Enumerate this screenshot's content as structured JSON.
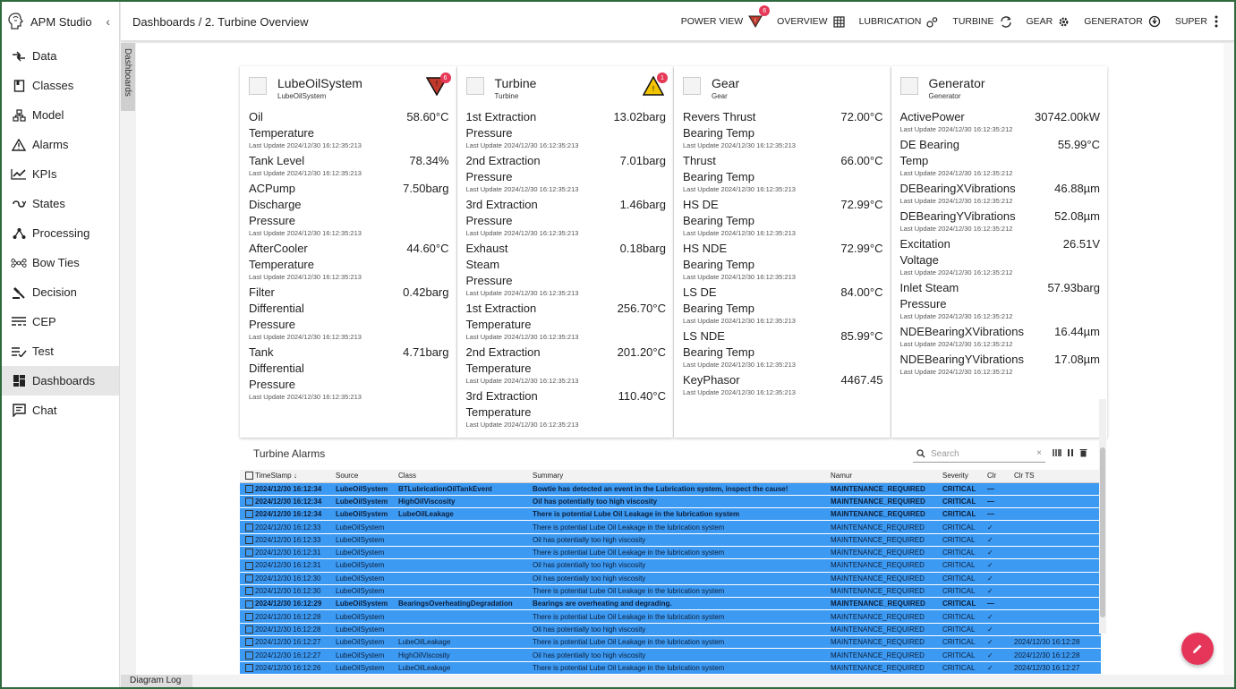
{
  "app": {
    "title": "APM Studio"
  },
  "sidebar": {
    "items": [
      {
        "label": "Data",
        "icon": "data-arrows-icon"
      },
      {
        "label": "Classes",
        "icon": "book-icon"
      },
      {
        "label": "Model",
        "icon": "tree-icon"
      },
      {
        "label": "Alarms",
        "icon": "warning-icon"
      },
      {
        "label": "KPIs",
        "icon": "chart-line-icon"
      },
      {
        "label": "States",
        "icon": "route-icon"
      },
      {
        "label": "Processing",
        "icon": "graph-icon"
      },
      {
        "label": "Bow Ties",
        "icon": "bowtie-icon"
      },
      {
        "label": "Decision",
        "icon": "gavel-icon"
      },
      {
        "label": "CEP",
        "icon": "cep-icon"
      },
      {
        "label": "Test",
        "icon": "checklist-icon"
      },
      {
        "label": "Dashboards",
        "icon": "dashboard-icon",
        "active": true
      },
      {
        "label": "Chat",
        "icon": "chat-icon"
      }
    ]
  },
  "sidetab": {
    "label": "Dashboards"
  },
  "header": {
    "breadcrumb": "Dashboards / 2. Turbine Overview",
    "links": [
      {
        "label": "POWER VIEW",
        "badge": "6"
      },
      {
        "label": "OVERVIEW"
      },
      {
        "label": "LUBRICATION"
      },
      {
        "label": "TURBINE"
      },
      {
        "label": "GEAR"
      },
      {
        "label": "GENERATOR"
      },
      {
        "label": "SUPER"
      }
    ]
  },
  "cards": [
    {
      "title": "LubeOilSystem",
      "subtitle": "LubeOilSystem",
      "alarm_badge": "6",
      "alarm_color": "#c0392b",
      "metrics": [
        {
          "name": "Oil\nTemperature",
          "value": "58.60°C",
          "update": "Last Update 2024/12/30 16:12:35:213"
        },
        {
          "name": "Tank Level",
          "value": "78.34%",
          "update": "Last Update 2024/12/30 16:12:35:213"
        },
        {
          "name": "ACPump\nDischarge\nPressure",
          "value": "7.50barg",
          "update": "Last Update 2024/12/30 16:12:35:213"
        },
        {
          "name": "AfterCooler\nTemperature",
          "value": "44.60°C",
          "update": "Last Update 2024/12/30 16:12:35:213"
        },
        {
          "name": "Filter\nDifferential\nPressure",
          "value": "0.42barg",
          "update": "Last Update 2024/12/30 16:12:35:213"
        },
        {
          "name": "Tank\nDifferential\nPressure",
          "value": "4.71barg",
          "update": "Last Update 2024/12/30 16:12:35:213"
        }
      ]
    },
    {
      "title": "Turbine",
      "subtitle": "Turbine",
      "alarm_badge": "1",
      "alarm_color": "#f2c400",
      "metrics": [
        {
          "name": "1st Extraction\nPressure",
          "value": "13.02barg",
          "update": "Last Update 2024/12/30 16:12:35:213"
        },
        {
          "name": "2nd Extraction\nPressure",
          "value": "7.01barg",
          "update": "Last Update 2024/12/30 16:12:35:213"
        },
        {
          "name": "3rd Extraction\nPressure",
          "value": "1.46barg",
          "update": "Last Update 2024/12/30 16:12:35:213"
        },
        {
          "name": "Exhaust\nSteam\nPressure",
          "value": "0.18barg",
          "update": "Last Update 2024/12/30 16:12:35:213"
        },
        {
          "name": "1st Extraction\nTemperature",
          "value": "256.70°C",
          "update": "Last Update 2024/12/30 16:12:35:213"
        },
        {
          "name": "2nd Extraction\nTemperature",
          "value": "201.20°C",
          "update": "Last Update 2024/12/30 16:12:35:213"
        },
        {
          "name": "3rd Extraction\nTemperature",
          "value": "110.40°C",
          "update": "Last Update 2024/12/30 16:12:35:213"
        }
      ]
    },
    {
      "title": "Gear",
      "subtitle": "Gear",
      "alarm_badge": "",
      "alarm_color": "",
      "metrics": [
        {
          "name": "Revers Thrust\nBearing Temp",
          "value": "72.00°C",
          "update": "Last Update 2024/12/30 16:12:35:213"
        },
        {
          "name": "Thrust\nBearing Temp",
          "value": "66.00°C",
          "update": "Last Update 2024/12/30 16:12:35:213"
        },
        {
          "name": "HS DE\nBearing Temp",
          "value": "72.99°C",
          "update": "Last Update 2024/12/30 16:12:35:213"
        },
        {
          "name": "HS NDE\nBearing Temp",
          "value": "72.99°C",
          "update": "Last Update 2024/12/30 16:12:35:213"
        },
        {
          "name": "LS DE\nBearing Temp",
          "value": "84.00°C",
          "update": "Last Update 2024/12/30 16:12:35:213"
        },
        {
          "name": "LS NDE\nBearing Temp",
          "value": "85.99°C",
          "update": "Last Update 2024/12/30 16:12:35:213"
        },
        {
          "name": "KeyPhasor",
          "value": "4467.45",
          "update": "Last Update 2024/12/30 16:12:35:213"
        }
      ]
    },
    {
      "title": "Generator",
      "subtitle": "Generator",
      "alarm_badge": "",
      "alarm_color": "",
      "metrics": [
        {
          "name": "ActivePower",
          "value": "30742.00kW",
          "update": "Last Update 2024/12/30 16:12:35:212"
        },
        {
          "name": "DE Bearing\nTemp",
          "value": "55.99°C",
          "update": "Last Update 2024/12/30 16:12:35:212"
        },
        {
          "name": "DEBearingXVibrations",
          "value": "46.88µm",
          "update": "Last Update 2024/12/30 16:12:35:212"
        },
        {
          "name": "DEBearingYVibrations",
          "value": "52.08µm",
          "update": "Last Update 2024/12/30 16:12:35:212"
        },
        {
          "name": "Excitation\nVoltage",
          "value": "26.51V",
          "update": "Last Update 2024/12/30 16:12:35:212"
        },
        {
          "name": "Inlet Steam\nPressure",
          "value": "57.93barg",
          "update": "Last Update 2024/12/30 16:12:35:212"
        },
        {
          "name": "NDEBearingXVibrations",
          "value": "16.44µm",
          "update": "Last Update 2024/12/30 16:12:35:212"
        },
        {
          "name": "NDEBearingYVibrations",
          "value": "17.08µm",
          "update": "Last Update 2024/12/30 16:12:35:212"
        }
      ]
    }
  ],
  "alarms": {
    "title": "Turbine Alarms",
    "search_placeholder": "Search",
    "columns": [
      "TimeStamp",
      "Source",
      "Class",
      "Summary",
      "Namur",
      "Severity",
      "Clr",
      "Clr TS"
    ],
    "rows": [
      {
        "ts": "2024/12/30 16:12:34",
        "src": "LubeOilSystem",
        "cls": "BTLubricationOilTankEvent",
        "sum": "Bowtie has detected an event in the Lubrication system, inspect the cause!",
        "namur": "MAINTENANCE_REQUIRED",
        "sev": "CRITICAL",
        "clr": "—",
        "clrts": "",
        "bold": true
      },
      {
        "ts": "2024/12/30 16:12:34",
        "src": "LubeOilSystem",
        "cls": "HighOilViscosity",
        "sum": "Oil has potentially too high viscosity",
        "namur": "MAINTENANCE_REQUIRED",
        "sev": "CRITICAL",
        "clr": "—",
        "clrts": "",
        "bold": true
      },
      {
        "ts": "2024/12/30 16:12:34",
        "src": "LubeOilSystem",
        "cls": "LubeOilLeakage",
        "sum": "There is potential Lube Oil Leakage in the lubrication system",
        "namur": "MAINTENANCE_REQUIRED",
        "sev": "CRITICAL",
        "clr": "—",
        "clrts": "",
        "bold": true
      },
      {
        "ts": "2024/12/30 16:12:33",
        "src": "LubeOilSystem",
        "cls": "",
        "sum": "There is potential Lube Oil Leakage in the lubrication system",
        "namur": "MAINTENANCE_REQUIRED",
        "sev": "CRITICAL",
        "clr": "✓",
        "clrts": "",
        "bold": false
      },
      {
        "ts": "2024/12/30 16:12:33",
        "src": "LubeOilSystem",
        "cls": "",
        "sum": "Oil has potentially too high viscosity",
        "namur": "MAINTENANCE_REQUIRED",
        "sev": "CRITICAL",
        "clr": "✓",
        "clrts": "",
        "bold": false
      },
      {
        "ts": "2024/12/30 16:12:31",
        "src": "LubeOilSystem",
        "cls": "",
        "sum": "There is potential Lube Oil Leakage in the lubrication system",
        "namur": "MAINTENANCE_REQUIRED",
        "sev": "CRITICAL",
        "clr": "✓",
        "clrts": "",
        "bold": false
      },
      {
        "ts": "2024/12/30 16:12:31",
        "src": "LubeOilSystem",
        "cls": "",
        "sum": "Oil has potentially too high viscosity",
        "namur": "MAINTENANCE_REQUIRED",
        "sev": "CRITICAL",
        "clr": "✓",
        "clrts": "",
        "bold": false
      },
      {
        "ts": "2024/12/30 16:12:30",
        "src": "LubeOilSystem",
        "cls": "",
        "sum": "Oil has potentially too high viscosity",
        "namur": "MAINTENANCE_REQUIRED",
        "sev": "CRITICAL",
        "clr": "✓",
        "clrts": "",
        "bold": false
      },
      {
        "ts": "2024/12/30 16:12:30",
        "src": "LubeOilSystem",
        "cls": "",
        "sum": "There is potential Lube Oil Leakage in the lubrication system",
        "namur": "MAINTENANCE_REQUIRED",
        "sev": "CRITICAL",
        "clr": "✓",
        "clrts": "",
        "bold": false
      },
      {
        "ts": "2024/12/30 16:12:29",
        "src": "LubeOilSystem",
        "cls": "BearingsOverheatingDegradation",
        "sum": "Bearings are overheating and degrading.",
        "namur": "MAINTENANCE_REQUIRED",
        "sev": "CRITICAL",
        "clr": "—",
        "clrts": "",
        "bold": true
      },
      {
        "ts": "2024/12/30 16:12:28",
        "src": "LubeOilSystem",
        "cls": "",
        "sum": "There is potential Lube Oil Leakage in the lubrication system",
        "namur": "MAINTENANCE_REQUIRED",
        "sev": "CRITICAL",
        "clr": "✓",
        "clrts": "",
        "bold": false
      },
      {
        "ts": "2024/12/30 16:12:28",
        "src": "LubeOilSystem",
        "cls": "",
        "sum": "Oil has potentially too high viscosity",
        "namur": "MAINTENANCE_REQUIRED",
        "sev": "CRITICAL",
        "clr": "✓",
        "clrts": "",
        "bold": false
      },
      {
        "ts": "2024/12/30 16:12:27",
        "src": "LubeOilSystem",
        "cls": "LubeOilLeakage",
        "sum": "There is potential Lube Oil Leakage in the lubrication system",
        "namur": "MAINTENANCE_REQUIRED",
        "sev": "CRITICAL",
        "clr": "✓",
        "clrts": "2024/12/30 16:12:28",
        "bold": false
      },
      {
        "ts": "2024/12/30 16:12:27",
        "src": "LubeOilSystem",
        "cls": "HighOilViscosity",
        "sum": "Oil has potentially too high viscosity",
        "namur": "MAINTENANCE_REQUIRED",
        "sev": "CRITICAL",
        "clr": "✓",
        "clrts": "2024/12/30 16:12:28",
        "bold": false
      },
      {
        "ts": "2024/12/30 16:12:26",
        "src": "LubeOilSystem",
        "cls": "LubeOilLeakage",
        "sum": "There is potential Lube Oil Leakage in the lubrication system",
        "namur": "MAINTENANCE_REQUIRED",
        "sev": "CRITICAL",
        "clr": "✓",
        "clrts": "2024/12/30 16:12:27",
        "bold": false
      }
    ]
  },
  "footer": {
    "diagram_log": "Diagram Log"
  },
  "colors": {
    "row_selected": "#3d9af2",
    "fab": "#e5365a",
    "badge": "#e53957"
  }
}
